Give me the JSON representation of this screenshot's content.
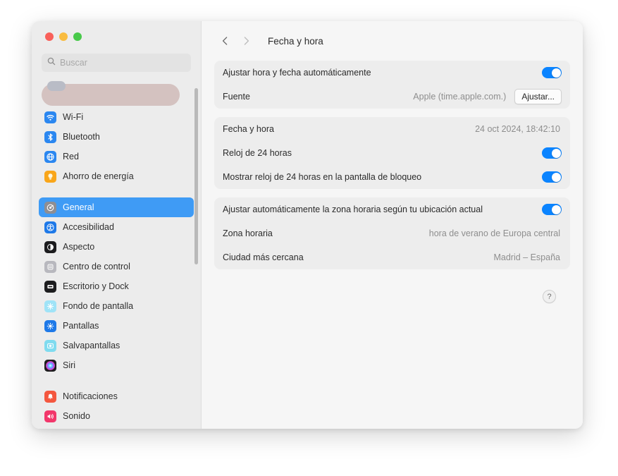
{
  "window": {
    "traffic_lights": [
      {
        "name": "close",
        "color": "#f9605a"
      },
      {
        "name": "minimize",
        "color": "#f9bc40"
      },
      {
        "name": "zoom",
        "color": "#48c94a"
      }
    ]
  },
  "sidebar": {
    "search": {
      "placeholder": "Buscar",
      "value": "",
      "icon": "search-icon"
    },
    "account": {
      "redacted": true
    },
    "groups": [
      {
        "items": [
          {
            "label": "Wi-Fi",
            "icon": "wifi-icon",
            "icon_bg": "#2b87f0",
            "glyph": "◝",
            "selected": false
          },
          {
            "label": "Bluetooth",
            "icon": "bluetooth-icon",
            "icon_bg": "#2b87f0",
            "glyph": "ᛗ",
            "selected": false
          },
          {
            "label": "Red",
            "icon": "network-globe-icon",
            "icon_bg": "#2b87f0",
            "glyph": "⬤",
            "selected": false
          },
          {
            "label": "Ahorro de energía",
            "icon": "battery-saver-icon",
            "icon_bg": "#f9a61a",
            "glyph": "●",
            "selected": false
          }
        ]
      },
      {
        "items": [
          {
            "label": "General",
            "icon": "general-gear-icon",
            "icon_bg": "#8e8e93",
            "glyph": "⚙",
            "selected": true
          },
          {
            "label": "Accesibilidad",
            "icon": "accessibility-icon",
            "icon_bg": "#1e79e8",
            "glyph": "⚿",
            "selected": false
          },
          {
            "label": "Aspecto",
            "icon": "appearance-icon",
            "icon_bg": "#1c1c1e",
            "glyph": "◑",
            "selected": false
          },
          {
            "label": "Centro de control",
            "icon": "control-center-icon",
            "icon_bg": "#b8b8be",
            "glyph": "≡",
            "selected": false
          },
          {
            "label": "Escritorio y Dock",
            "icon": "desktop-dock-icon",
            "icon_bg": "#1c1c1e",
            "glyph": "▬",
            "selected": false
          },
          {
            "label": "Fondo de pantalla",
            "icon": "wallpaper-icon",
            "icon_bg": "#9fe3f7",
            "glyph": "❄",
            "selected": false
          },
          {
            "label": "Pantallas",
            "icon": "displays-icon",
            "icon_bg": "#1e79e8",
            "glyph": "☀",
            "selected": false
          },
          {
            "label": "Salvapantallas",
            "icon": "screensaver-icon",
            "icon_bg": "#7fdbef",
            "glyph": "◴",
            "selected": false
          },
          {
            "label": "Siri",
            "icon": "siri-icon",
            "icon_bg": "#1c1c1e",
            "glyph": "●",
            "selected": false
          }
        ]
      },
      {
        "items": [
          {
            "label": "Notificaciones",
            "icon": "notifications-icon",
            "icon_bg": "#f4573f",
            "glyph": "▲",
            "selected": false
          },
          {
            "label": "Sonido",
            "icon": "sound-icon",
            "icon_bg": "#f2376b",
            "glyph": "◀",
            "selected": false
          }
        ]
      }
    ]
  },
  "toolbar": {
    "back_icon": "chevron-left-icon",
    "forward_icon": "chevron-right-icon",
    "title": "Fecha y hora"
  },
  "sections": [
    {
      "name": "auto-time-section",
      "rows": [
        {
          "name": "auto-set-time-row",
          "label": "Ajustar hora y fecha automáticamente",
          "control": "toggle",
          "toggle_on": true
        },
        {
          "name": "time-source-row",
          "label": "Fuente",
          "value": "Apple (time.apple.com.)",
          "control": "button",
          "button_label": "Ajustar..."
        }
      ]
    },
    {
      "name": "clock-section",
      "rows": [
        {
          "name": "date-time-row",
          "label": "Fecha y hora",
          "value": "24 oct 2024, 18:42:10",
          "control": "none"
        },
        {
          "name": "24h-clock-row",
          "label": "Reloj de 24 horas",
          "control": "toggle",
          "toggle_on": true
        },
        {
          "name": "24h-lockscreen-row",
          "label": "Mostrar reloj de 24 horas en la pantalla de bloqueo",
          "control": "toggle",
          "toggle_on": true
        }
      ]
    },
    {
      "name": "timezone-section",
      "rows": [
        {
          "name": "auto-timezone-row",
          "label": "Ajustar automáticamente la zona horaria según tu ubicación actual",
          "control": "toggle",
          "toggle_on": true
        },
        {
          "name": "timezone-row",
          "label": "Zona horaria",
          "value": "hora de verano de Europa central",
          "control": "none"
        },
        {
          "name": "nearest-city-row",
          "label": "Ciudad más cercana",
          "value": "Madrid – España",
          "control": "none"
        }
      ]
    }
  ],
  "help": {
    "label": "?",
    "icon": "help-question-icon"
  },
  "colors": {
    "accent_blue": "#0b84ff",
    "selection_blue": "#3f9bf5",
    "window_bg": "#f2f2f2",
    "sidebar_bg": "#ececec",
    "content_bg": "#f6f6f6",
    "card_bg": "#ededed",
    "value_text": "#8e8e8e"
  }
}
